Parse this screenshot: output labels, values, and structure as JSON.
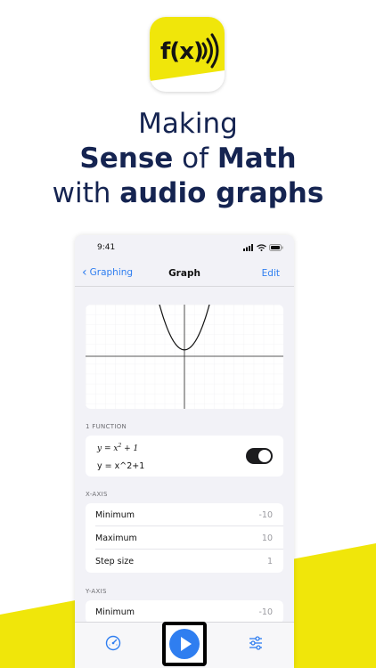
{
  "headline": {
    "line1": "Making",
    "line2_bold1": "Sense",
    "line2_mid": " of ",
    "line2_bold2": "Math",
    "line3_pre": "with ",
    "line3_bold": "audio graphs"
  },
  "app_icon": {
    "label": "f(x)"
  },
  "status_bar": {
    "time": "9:41"
  },
  "nav": {
    "back_label": "Graphing",
    "title": "Graph",
    "edit_label": "Edit"
  },
  "functions": {
    "header": "1 FUNCTION",
    "items": [
      {
        "eq_prefix": "y = x",
        "eq_exp": "2",
        "eq_suffix": " + 1",
        "text": "y = x^2+1",
        "enabled": true
      }
    ]
  },
  "x_axis": {
    "header": "X-AXIS",
    "rows": [
      {
        "label": "Minimum",
        "value": "-10"
      },
      {
        "label": "Maximum",
        "value": "10"
      },
      {
        "label": "Step size",
        "value": "1"
      }
    ]
  },
  "y_axis": {
    "header": "Y-AXIS",
    "rows": [
      {
        "label": "Minimum",
        "value": "-10"
      }
    ]
  },
  "tabs": {
    "left_icon": "gauge-icon",
    "center_icon": "play-icon",
    "right_icon": "sliders-icon"
  },
  "colors": {
    "accent": "#2f7ef0",
    "brand_yellow": "#f0e60a",
    "headline": "#152451"
  }
}
